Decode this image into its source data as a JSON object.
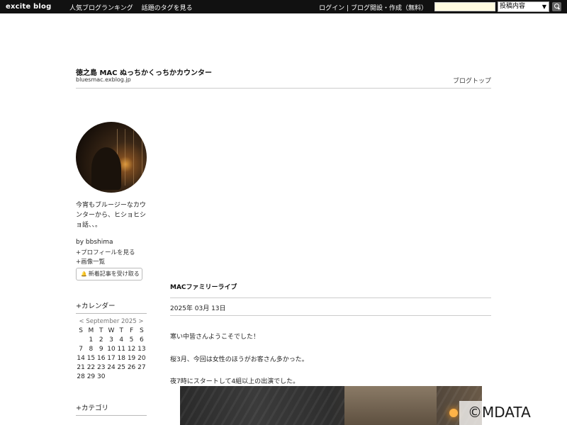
{
  "topbar": {
    "logo": "excite blog",
    "nav": [
      "人気ブログランキング",
      "話題のタグを見る"
    ],
    "login": "ログイン",
    "separator": "|",
    "create": "ブログ開設・作成（無料）",
    "search_select": "投稿内容"
  },
  "header": {
    "title": "徳之島 MAC ぬっちかくっちかカウンター",
    "url": "bluesmac.exblog.jp",
    "top_link": "ブログトップ"
  },
  "sidebar": {
    "profile_lines": [
      "今宵もブルージーなカウ",
      "ンターから、ヒショヒシ",
      "ョ話、、。"
    ],
    "by_user": "by bbshima",
    "links": [
      "+プロフィールを見る",
      "+画像一覧"
    ],
    "follow_button": "新着記事を受け取る",
    "calendar_heading": "+カレンダー",
    "calendar": {
      "prev": "<",
      "month": "September 2025",
      "next": ">",
      "weekdays": [
        "S",
        "M",
        "T",
        "W",
        "T",
        "F",
        "S"
      ],
      "weeks": [
        [
          "",
          "1",
          "2",
          "3",
          "4",
          "5",
          "6"
        ],
        [
          "7",
          "8",
          "9",
          "10",
          "11",
          "12",
          "13"
        ],
        [
          "14",
          "15",
          "16",
          "17",
          "18",
          "19",
          "20"
        ],
        [
          "21",
          "22",
          "23",
          "24",
          "25",
          "26",
          "27"
        ],
        [
          "28",
          "29",
          "30",
          "",
          "",
          "",
          ""
        ]
      ]
    },
    "category_heading": "+カテゴリ"
  },
  "post": {
    "title": "MACファミリーライブ",
    "date": "2025年 03月 13日",
    "paragraphs": [
      "寒い中皆さんようこそでした！",
      "桜3月、今回は女性のほうがお客さん多かった。",
      "夜7時にスタートして4組以上の出演でした。"
    ]
  },
  "watermark": "©MDATA"
}
